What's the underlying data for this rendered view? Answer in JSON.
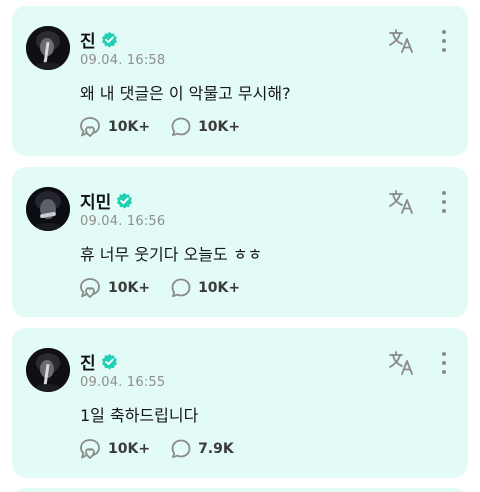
{
  "posts": [
    {
      "author": "진",
      "timestamp": "09.04. 16:58",
      "message": "왜 내 댓글은 이 악물고 무시해?",
      "likes": "10K+",
      "comments": "10K+"
    },
    {
      "author": "지민",
      "timestamp": "09.04. 16:56",
      "message": "휴 너무 웃기다 오늘도 ㅎㅎ",
      "likes": "10K+",
      "comments": "10K+"
    },
    {
      "author": "진",
      "timestamp": "09.04. 16:55",
      "message": "1일 축하드립니다",
      "likes": "10K+",
      "comments": "7.9K"
    }
  ],
  "icons": {
    "verified": "verified-badge-icon",
    "translate": "translate-icon",
    "more": "more-vertical-icon",
    "like": "bubble-heart-icon",
    "comment": "comment-bubble-icon"
  },
  "colors": {
    "card_background": "#e3fbf6",
    "verified_badge": "#1fd0b5",
    "icon_gray": "#8a8a8a",
    "timestamp_gray": "#8e8e8e"
  }
}
